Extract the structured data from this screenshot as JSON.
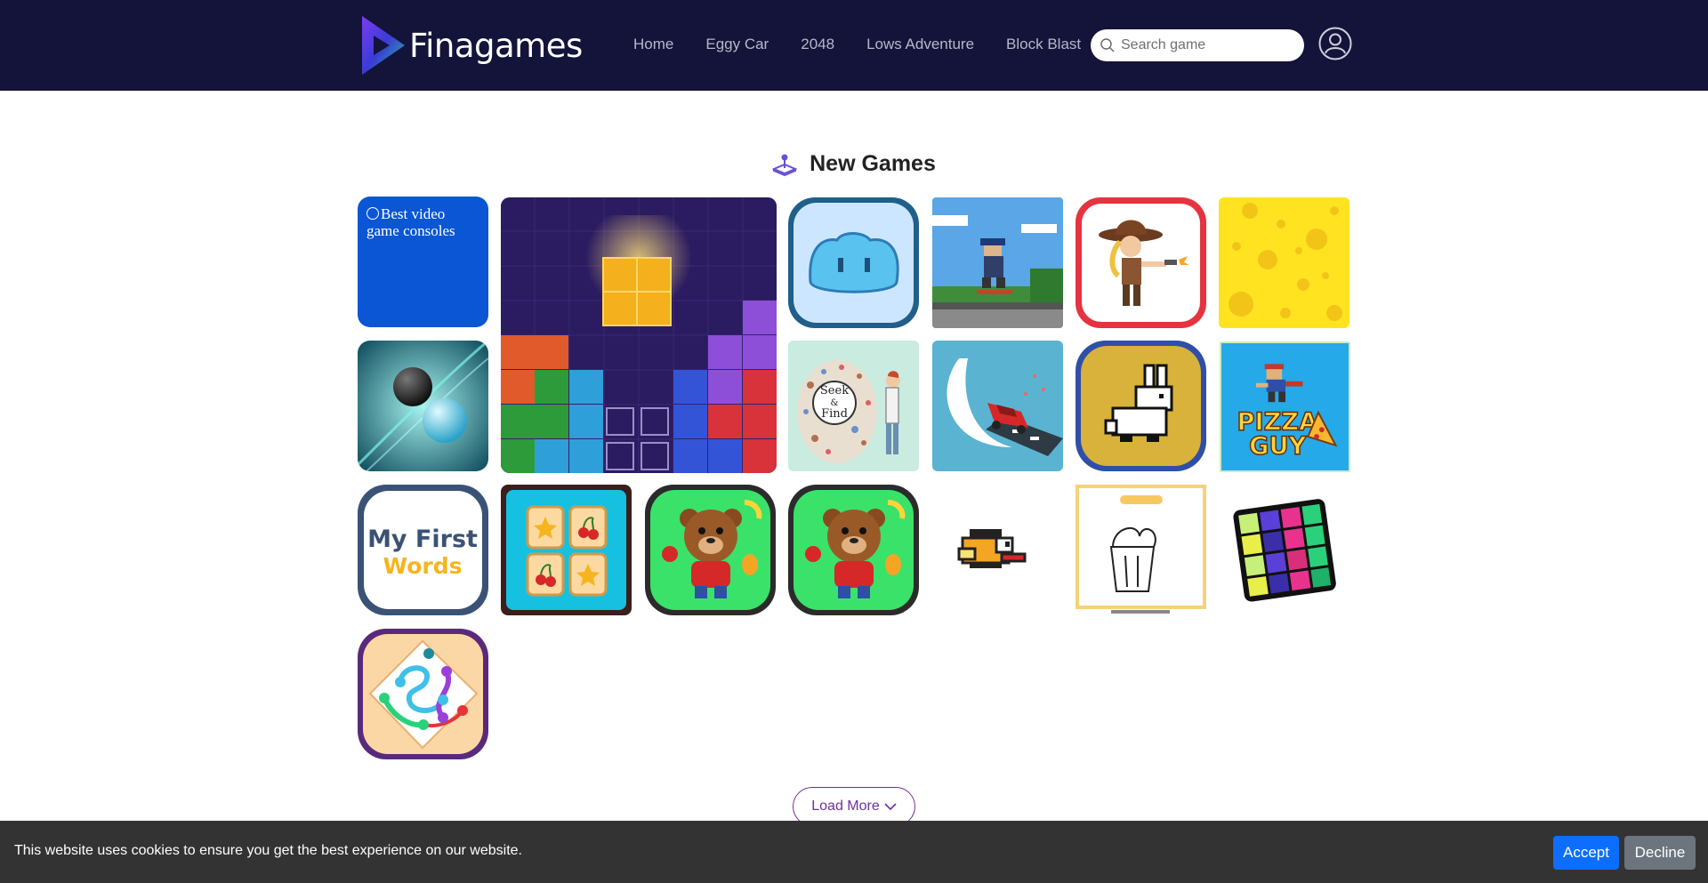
{
  "header": {
    "logo_text": "Finagames",
    "nav": [
      "Home",
      "Eggy Car",
      "2048",
      "Lows Adventure",
      "Block Blast"
    ],
    "search_placeholder": "Search game"
  },
  "section": {
    "title": "New Games"
  },
  "ad": {
    "label": "Best video game consoles"
  },
  "games": [
    {
      "name": "block-blast",
      "thumb": "block-puzzle"
    },
    {
      "name": "blue-slime",
      "thumb": "slime"
    },
    {
      "name": "pixel-skater",
      "thumb": "skater"
    },
    {
      "name": "cowgirl-shooter",
      "thumb": "cowgirl"
    },
    {
      "name": "cheese",
      "thumb": "cheese"
    },
    {
      "name": "balls",
      "thumb": "balls"
    },
    {
      "name": "seek-and-find",
      "thumb": "seek-find"
    },
    {
      "name": "car-drift",
      "thumb": "car"
    },
    {
      "name": "pixel-rabbit",
      "thumb": "rabbit"
    },
    {
      "name": "pizza-guy",
      "thumb": "pizza-guy"
    },
    {
      "name": "my-first-words",
      "thumb": "words"
    },
    {
      "name": "memory-match",
      "thumb": "memory"
    },
    {
      "name": "bear-fruits-1",
      "thumb": "bear"
    },
    {
      "name": "bear-fruits-2",
      "thumb": "bear"
    },
    {
      "name": "flappy-bird",
      "thumb": "bird"
    },
    {
      "name": "ice-cream-drawing",
      "thumb": "icecream"
    },
    {
      "name": "color-grid",
      "thumb": "grid"
    },
    {
      "name": "connect-dots",
      "thumb": "connect"
    }
  ],
  "thumb_text": {
    "seek": "Seek",
    "and": "&",
    "find": "Find",
    "pizza": "PIZZA",
    "guy": "GUY",
    "my_first": "My First",
    "words": "Words"
  },
  "load_more": "Load More",
  "cookie": {
    "text": "This website uses cookies to ensure you get the best experience on our website.",
    "accept": "Accept",
    "decline": "Decline"
  },
  "colors": {
    "header_bg": "#14133a",
    "accent_purple": "#6f2f9a",
    "accept_blue": "#0d6efd",
    "decline_gray": "#6c757d",
    "cookie_bg": "#333333"
  }
}
